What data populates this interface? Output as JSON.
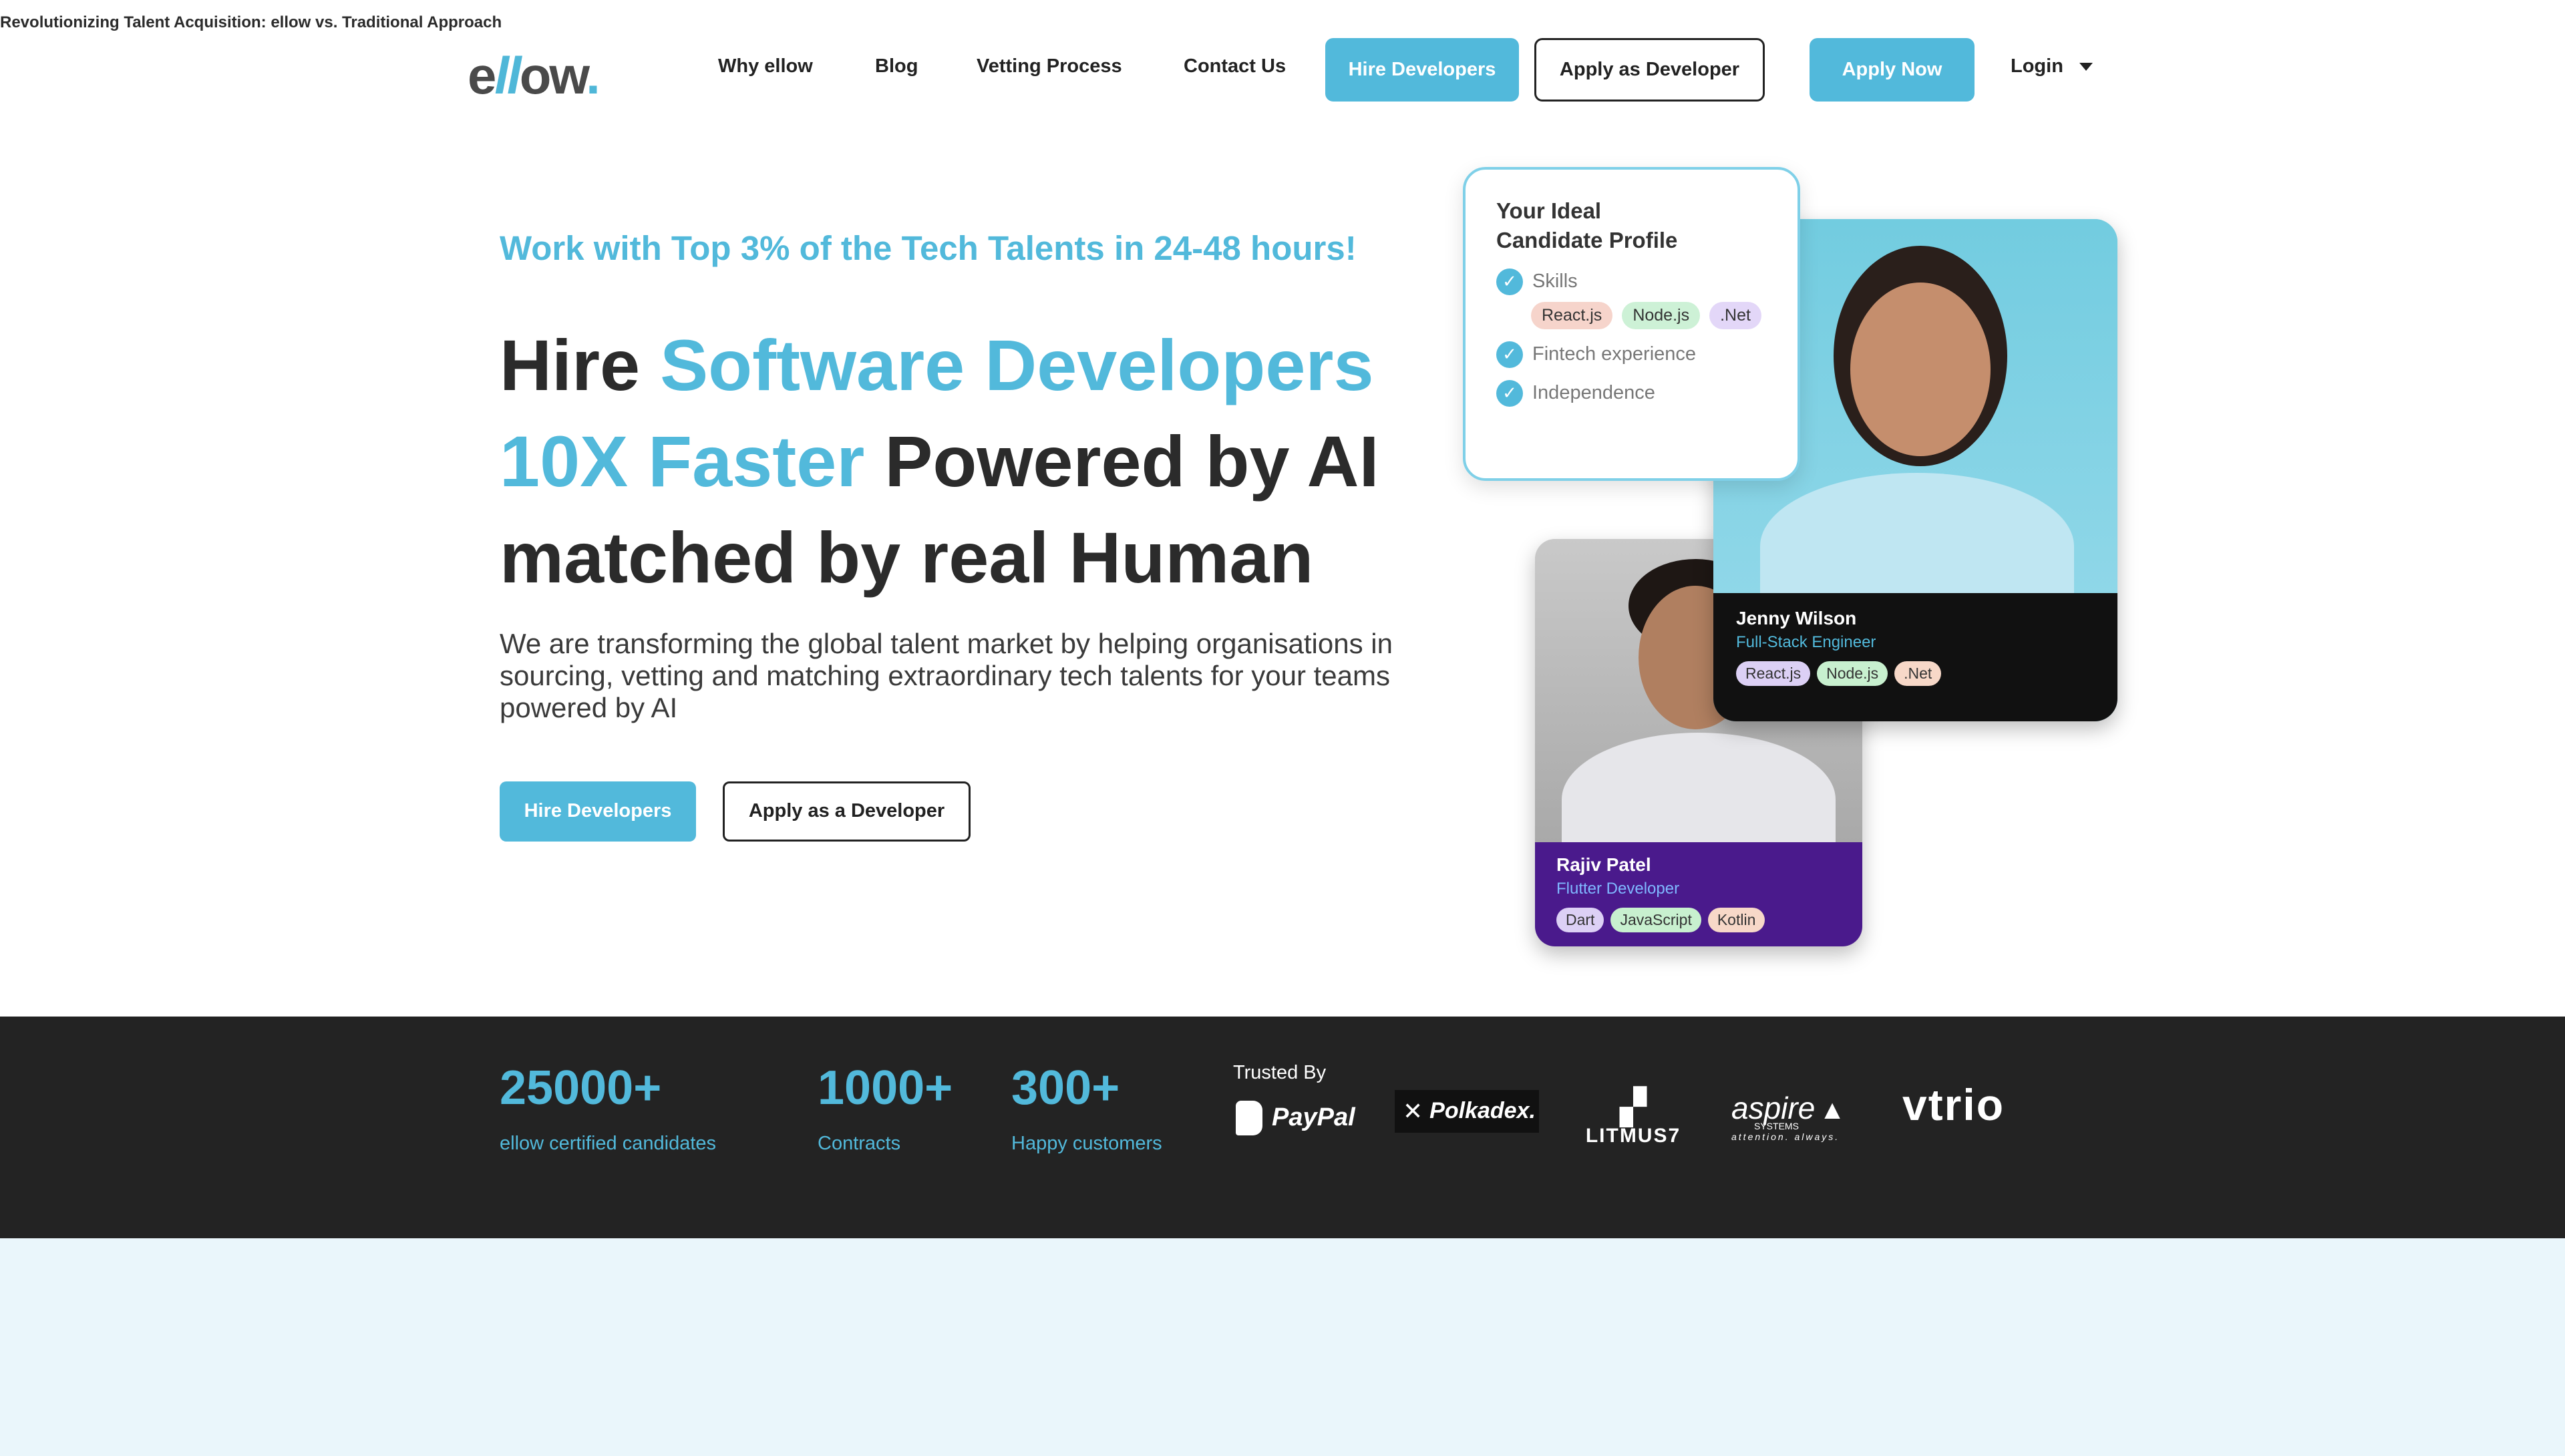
{
  "nav": {
    "logo": {
      "pre": "e",
      "mid": "ll",
      "post": "ow",
      "dot": "."
    },
    "links": [
      "Why ellow",
      "Blog",
      "Vetting Process",
      "Contact Us"
    ],
    "hire_developers": "Hire Developers",
    "apply_as_developer": "Apply as Developer",
    "apply_now": "Apply Now",
    "login": "Login"
  },
  "hero": {
    "tagline": "Work with Top 3% of the Tech Talents in 24-48 hours!",
    "headline": {
      "part1": "Hire ",
      "highlight1": "Software Developers",
      "highlight2": "10X Faster",
      "part2": " Powered by AI",
      "part3": "matched by real Human"
    },
    "lead": "We are transforming the global talent market by helping organisations in sourcing, vetting and matching extraordinary tech talents for your teams powered by AI",
    "hire_button": "Hire Developers",
    "apply_button": "Apply as a Developer"
  },
  "profile_card": {
    "title_line1": "Your Ideal",
    "title_line2": "Candidate Profile",
    "criteria": [
      "Skills",
      "Fintech experience",
      "Independence"
    ],
    "skills": [
      "React.js",
      "Node.js",
      ".Net"
    ]
  },
  "candidates": [
    {
      "name": "Jenny Wilson",
      "role": "Full-Stack Engineer",
      "role_color": "#52b9db",
      "skills": [
        "React.js",
        "Node.js",
        ".Net"
      ]
    },
    {
      "name": "Rajiv Patel",
      "role": "Flutter Developer",
      "role_color": "#7fb8ff",
      "skills": [
        "Dart",
        "JavaScript",
        "Kotlin"
      ]
    }
  ],
  "stats": [
    {
      "value": "25000+",
      "label": "ellow certified candidates"
    },
    {
      "value": "1000+",
      "label": "Contracts"
    },
    {
      "value": "300+",
      "label": "Happy customers"
    }
  ],
  "trusted": {
    "label": "Trusted By",
    "brands": [
      "PayPal",
      "Polkadex.",
      "LITMUS7",
      "aspire",
      "vtrio"
    ],
    "aspire_sub": "SYSTEMS",
    "aspire_tag": "attention. always."
  },
  "section": {
    "title": "Revolutionizing Talent Acquisition: ellow vs. Traditional Approach"
  },
  "colors": {
    "accent": "#52b9db",
    "dark": "#232323",
    "purple": "#4a1a8c",
    "light_bg": "#eaf6fb"
  }
}
